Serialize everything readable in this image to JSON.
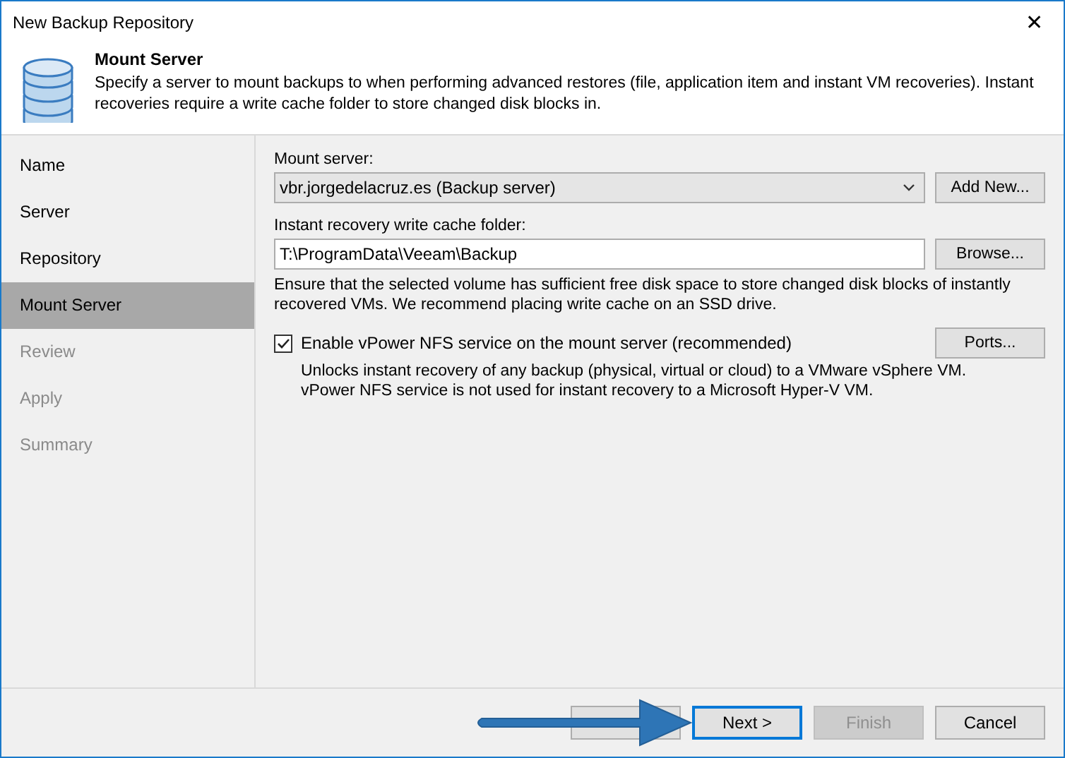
{
  "window": {
    "title": "New Backup Repository",
    "close": "✕"
  },
  "header": {
    "title": "Mount Server",
    "description": "Specify a server to mount backups to when performing advanced restores (file, application item and instant VM recoveries). Instant recoveries require a write cache folder to store changed disk blocks in."
  },
  "sidebar": {
    "items": [
      {
        "label": "Name",
        "selected": false,
        "disabled": false
      },
      {
        "label": "Server",
        "selected": false,
        "disabled": false
      },
      {
        "label": "Repository",
        "selected": false,
        "disabled": false
      },
      {
        "label": "Mount Server",
        "selected": true,
        "disabled": false
      },
      {
        "label": "Review",
        "selected": false,
        "disabled": true
      },
      {
        "label": "Apply",
        "selected": false,
        "disabled": true
      },
      {
        "label": "Summary",
        "selected": false,
        "disabled": true
      }
    ]
  },
  "mount_server": {
    "label": "Mount server:",
    "value": "vbr.jorgedelacruz.es (Backup server)",
    "button": "Add New..."
  },
  "cache_folder": {
    "label": "Instant recovery write cache folder:",
    "value": "T:\\ProgramData\\Veeam\\Backup",
    "button": "Browse...",
    "hint": "Ensure that the selected volume has sufficient free disk space to store changed disk blocks of instantly recovered VMs. We recommend placing write cache on an SSD drive."
  },
  "vpower": {
    "label": "Enable vPower NFS service on the mount server (recommended)",
    "checked": true,
    "button": "Ports...",
    "hint": "Unlocks instant recovery of any backup (physical, virtual or cloud) to a VMware vSphere VM.\nvPower NFS service is not used for instant recovery to a Microsoft Hyper-V VM."
  },
  "buttons": [
    {
      "disabled": false,
      "focused": false
    },
    {
      "label": "Next >",
      "disabled": false,
      "focused": true
    },
    {
      "label": "Finish",
      "disabled": true,
      "focused": false
    },
    {
      "label": "Cancel",
      "disabled": false,
      "focused": false
    }
  ]
}
